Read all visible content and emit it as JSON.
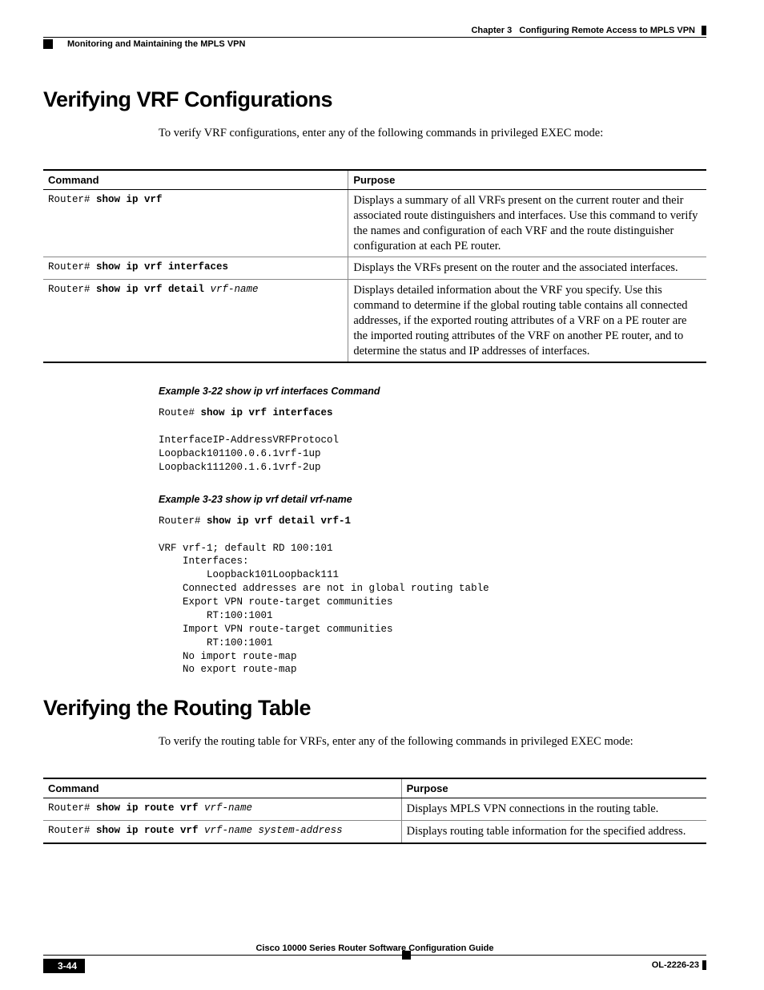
{
  "header": {
    "chapter_label": "Chapter 3",
    "chapter_title": "Configuring Remote Access to MPLS VPN",
    "section_title": "Monitoring and Maintaining the MPLS VPN"
  },
  "section1": {
    "heading": "Verifying VRF Configurations",
    "intro": "To verify VRF configurations, enter any of the following commands in privileged EXEC mode:",
    "table": {
      "headers": [
        "Command",
        "Purpose"
      ],
      "rows": [
        {
          "prompt": "Router# ",
          "cmd_bold": "show ip vrf",
          "cmd_italic": "",
          "purpose": "Displays a summary of all VRFs present on the current router and their associated route distinguishers and interfaces. Use this command to verify the names and configuration of each VRF and the route distinguisher configuration at each PE router."
        },
        {
          "prompt": "Router# ",
          "cmd_bold": "show ip vrf interfaces",
          "cmd_italic": "",
          "purpose": "Displays the VRFs present on the router and the associated interfaces."
        },
        {
          "prompt": "Router# ",
          "cmd_bold": "show ip vrf detail",
          "cmd_italic": " vrf-name",
          "purpose": "Displays detailed information about the VRF you specify. Use this command to determine if the global routing table contains all connected addresses, if the exported routing attributes of a VRF on a PE router are the imported routing attributes of the VRF on another PE router, and to determine the status and IP addresses of interfaces."
        }
      ]
    },
    "example1": {
      "title": "Example 3-22   show ip vrf interfaces Command",
      "prompt": "Route# ",
      "cmd": "show ip vrf interfaces",
      "body": "InterfaceIP-AddressVRFProtocol\nLoopback101100.0.6.1vrf-1up\nLoopback111200.1.6.1vrf-2up"
    },
    "example2": {
      "title": "Example 3-23   show ip vrf detail vrf-name",
      "prompt": "Router# ",
      "cmd": "show ip vrf detail vrf-1",
      "body": "VRF vrf-1; default RD 100:101\n    Interfaces:\n        Loopback101Loopback111\n    Connected addresses are not in global routing table\n    Export VPN route-target communities\n        RT:100:1001\n    Import VPN route-target communities\n        RT:100:1001\n    No import route-map\n    No export route-map"
    }
  },
  "section2": {
    "heading": "Verifying the Routing Table",
    "intro": "To verify the routing table for VRFs, enter any of the following commands in privileged EXEC mode:",
    "table": {
      "headers": [
        "Command",
        "Purpose"
      ],
      "rows": [
        {
          "prompt": "Router# ",
          "cmd_bold": "show ip route vrf",
          "cmd_italic": " vrf-name",
          "purpose": "Displays MPLS VPN connections in the routing table."
        },
        {
          "prompt": "Router# ",
          "cmd_bold": "show ip route vrf",
          "cmd_italic": " vrf-name system-address",
          "purpose": "Displays routing table information for the specified address."
        }
      ]
    }
  },
  "footer": {
    "guide_title": "Cisco 10000 Series Router Software Configuration Guide",
    "page_number": "3-44",
    "doc_id": "OL-2226-23"
  }
}
